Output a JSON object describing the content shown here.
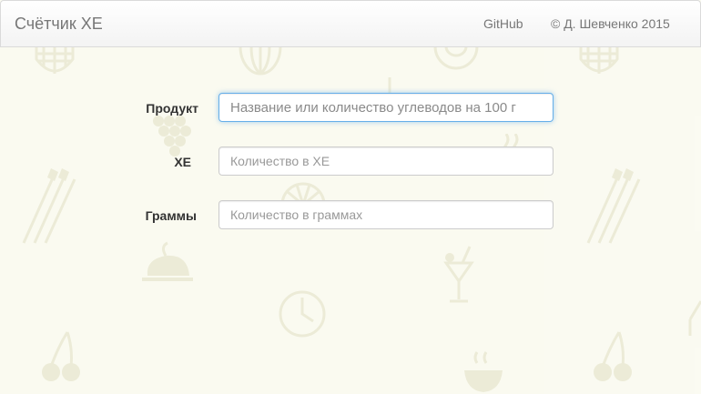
{
  "navbar": {
    "brand": "Счётчик ХЕ",
    "links": [
      {
        "label": "GitHub"
      },
      {
        "label": "© Д. Шевченко 2015"
      }
    ]
  },
  "form": {
    "product": {
      "label": "Продукт",
      "placeholder": "Название или количество углеводов на 100 г",
      "value": ""
    },
    "xe": {
      "label": "ХЕ",
      "placeholder": "Количество в ХЕ",
      "value": ""
    },
    "grams": {
      "label": "Граммы",
      "placeholder": "Количество в граммах",
      "value": ""
    }
  },
  "background": {
    "icons": [
      "waffle-icon",
      "watermelon-icon",
      "donut-icon",
      "grapes-icon",
      "asparagus-icon",
      "orange-slice-icon",
      "cocktail-icon",
      "roast-chicken-icon",
      "clock-icon",
      "cherries-icon",
      "soup-bowl-icon"
    ]
  },
  "colors": {
    "background": "#fafaf0",
    "pattern": "#ecebd7",
    "focus_border": "#66afe9"
  }
}
